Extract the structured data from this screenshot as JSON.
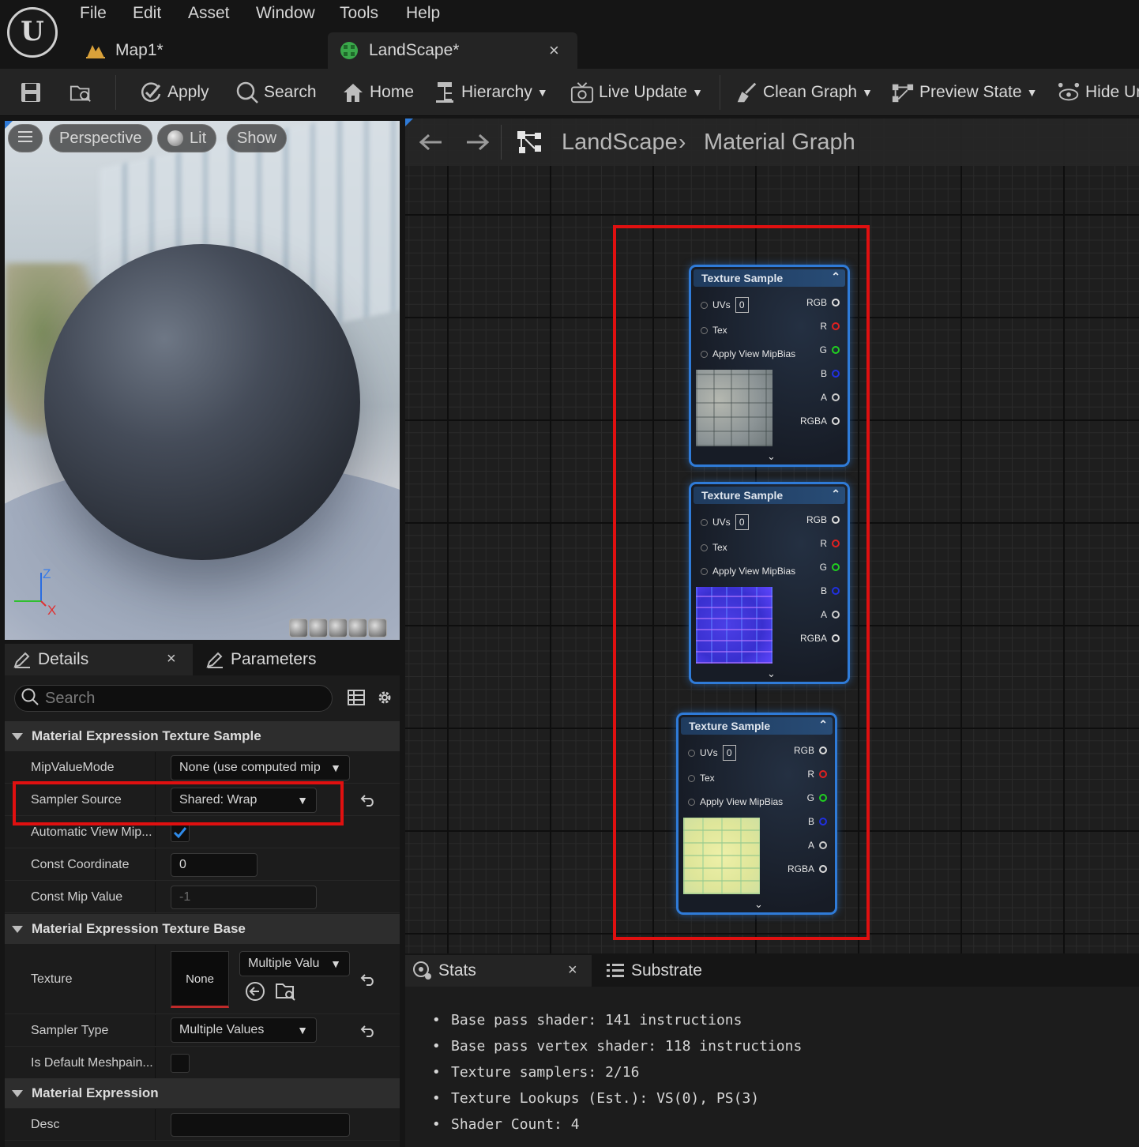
{
  "menu": {
    "items": [
      "File",
      "Edit",
      "Asset",
      "Window",
      "Tools",
      "Help"
    ]
  },
  "tabs": {
    "map": "Map1*",
    "landscape": "LandScape*",
    "close": "×"
  },
  "toolbar": {
    "apply": "Apply",
    "search": "Search",
    "home": "Home",
    "hierarchy": "Hierarchy",
    "live_update": "Live Update",
    "clean_graph": "Clean Graph",
    "preview_state": "Preview State",
    "hide_unrelated": "Hide Un"
  },
  "viewport": {
    "perspective": "Perspective",
    "lit": "Lit",
    "show": "Show",
    "axis_z": "Z",
    "axis_x": "X"
  },
  "details": {
    "tab_details": "Details",
    "tab_close": "×",
    "tab_parameters": "Parameters",
    "search_placeholder": "Search",
    "cat_texture_sample": "Material Expression Texture Sample",
    "cat_texture_base": "Material Expression Texture Base",
    "cat_expression": "Material Expression",
    "mip_value_mode_label": "MipValueMode",
    "mip_value_mode_value": "None (use computed mip",
    "sampler_source_label": "Sampler Source",
    "sampler_source_value": "Shared: Wrap",
    "auto_view_mip_label": "Automatic View Mip...",
    "auto_view_mip_checked": true,
    "const_coordinate_label": "Const Coordinate",
    "const_coordinate_value": "0",
    "const_mip_label": "Const Mip Value",
    "const_mip_value": "-1",
    "texture_label": "Texture",
    "texture_value": "None",
    "texture_multi": "Multiple Valu",
    "sampler_type_label": "Sampler Type",
    "sampler_type_value": "Multiple Values",
    "default_meshpaint_label": "Is Default Meshpain...",
    "default_meshpaint_checked": false,
    "desc_label": "Desc",
    "desc_value": ""
  },
  "graph": {
    "breadcrumb_root": "LandScape",
    "breadcrumb_current": "Material Graph",
    "nodes": [
      {
        "title": "Texture Sample",
        "uvs": "0",
        "texture": "stone"
      },
      {
        "title": "Texture Sample",
        "uvs": "0",
        "texture": "normal"
      },
      {
        "title": "Texture Sample",
        "uvs": "0",
        "texture": "yellow"
      }
    ],
    "inputs": {
      "uvs": "UVs",
      "tex": "Tex",
      "mipbias": "Apply View MipBias"
    },
    "outputs": {
      "rgb": "RGB",
      "r": "R",
      "g": "G",
      "b": "B",
      "a": "A",
      "rgba": "RGBA"
    },
    "pin_colors": {
      "rgb": "#dddddd",
      "r": "#e02020",
      "g": "#20d020",
      "b": "#2030e0",
      "a": "#cccccc",
      "rgba": "#dddddd"
    },
    "highlight_color": "#e01010",
    "selection_color": "#2f7bd8"
  },
  "stats": {
    "tab_stats": "Stats",
    "tab_close": "×",
    "tab_substrate": "Substrate",
    "lines": [
      "Base pass shader: 141 instructions",
      "Base pass vertex shader: 118 instructions",
      "Texture samplers: 2/16",
      "Texture Lookups (Est.): VS(0), PS(3)",
      "Shader Count: 4"
    ]
  }
}
